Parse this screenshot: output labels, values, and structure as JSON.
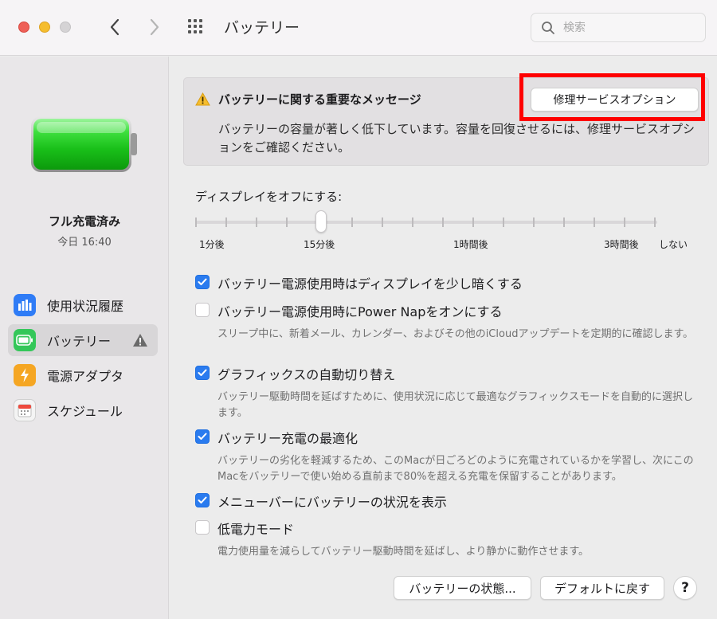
{
  "window": {
    "title": "バッテリー",
    "search_placeholder": "検索"
  },
  "sidebar": {
    "status": "フル充電済み",
    "time": "今日 16:40",
    "items": [
      {
        "label": "使用状況履歴",
        "icon": "bar-chart-icon"
      },
      {
        "label": "バッテリー",
        "icon": "battery-icon",
        "active": true,
        "warning": true
      },
      {
        "label": "電源アダプタ",
        "icon": "lightning-icon"
      },
      {
        "label": "スケジュール",
        "icon": "calendar-icon"
      }
    ]
  },
  "alert": {
    "title": "バッテリーに関する重要なメッセージ",
    "body": "バッテリーの容量が著しく低下しています。容量を回復させるには、修理サービスオプションをご確認ください。",
    "button": "修理サービスオプション"
  },
  "display": {
    "label": "ディスプレイをオフにする:",
    "ticks": [
      "1分後",
      "15分後",
      "1時間後",
      "3時間後",
      "しない"
    ],
    "value": "15分後"
  },
  "options": [
    {
      "label": "バッテリー電源使用時はディスプレイを少し暗くする",
      "checked": true,
      "desc": ""
    },
    {
      "label": "バッテリー電源使用時にPower Napをオンにする",
      "checked": false,
      "desc": "スリープ中に、新着メール、カレンダー、およびその他のiCloudアップデートを定期的に確認します。"
    },
    {
      "label": "グラフィックスの自動切り替え",
      "checked": true,
      "desc": "バッテリー駆動時間を延ばすために、使用状況に応じて最適なグラフィックスモードを自動的に選択します。"
    },
    {
      "label": "バッテリー充電の最適化",
      "checked": true,
      "desc": "バッテリーの劣化を軽減するため、このMacが日ごろどのように充電されているかを学習し、次にこのMacをバッテリーで使い始める直前まで80%を超える充電を保留することがあります。"
    },
    {
      "label": "メニューバーにバッテリーの状況を表示",
      "checked": true,
      "desc": ""
    },
    {
      "label": "低電力モード",
      "checked": false,
      "desc": "電力使用量を減らしてバッテリー駆動時間を延ばし、より静かに動作させます。"
    }
  ],
  "footer": {
    "status_button": "バッテリーの状態...",
    "default_button": "デフォルトに戻す",
    "help": "?"
  },
  "colors": {
    "accent": "#2a7bef",
    "warning": "#f5bd2e",
    "battery_green": "#2fd12f",
    "highlight": "#ff0000"
  }
}
